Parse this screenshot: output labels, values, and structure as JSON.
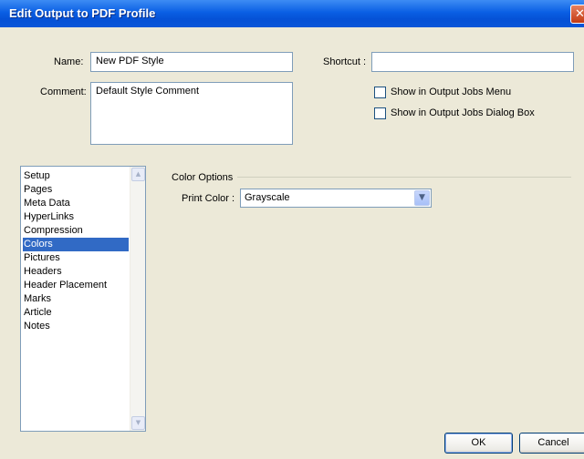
{
  "window": {
    "title": "Edit Output to PDF Profile",
    "close_glyph": "✕"
  },
  "form": {
    "name_label": "Name:",
    "name_value": "New PDF Style",
    "comment_label": "Comment:",
    "comment_value": "Default Style Comment",
    "shortcut_label": "Shortcut :",
    "shortcut_value": "",
    "show_menu_label": "Show in Output Jobs Menu",
    "show_menu_checked": false,
    "show_dialog_label": "Show in Output Jobs Dialog Box",
    "show_dialog_checked": false
  },
  "sidebar": {
    "selected": "Colors",
    "items": [
      {
        "label": "Setup"
      },
      {
        "label": "Pages"
      },
      {
        "label": "Meta Data"
      },
      {
        "label": "HyperLinks"
      },
      {
        "label": "Compression"
      },
      {
        "label": "Colors"
      },
      {
        "label": "Pictures"
      },
      {
        "label": "Headers"
      },
      {
        "label": "Header Placement"
      },
      {
        "label": "Marks"
      },
      {
        "label": "Article"
      },
      {
        "label": "Notes"
      }
    ]
  },
  "color_options": {
    "group_label": "Color Options",
    "print_color_label": "Print Color :",
    "print_color_value": "Grayscale"
  },
  "footer": {
    "ok_label": "OK",
    "cancel_label": "Cancel"
  },
  "icons": {
    "scroll_up": "▲",
    "scroll_down": "▼",
    "dropdown": "▼"
  }
}
